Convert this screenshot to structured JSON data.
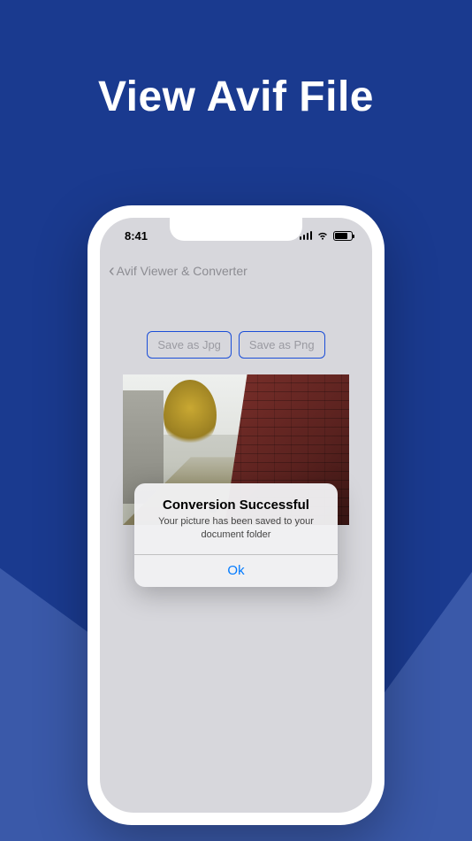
{
  "marketing": {
    "title": "View Avif File"
  },
  "statusbar": {
    "time": "8:41"
  },
  "nav": {
    "back_label": "Avif Viewer & Converter"
  },
  "actions": {
    "save_jpg": "Save as Jpg",
    "save_png": "Save as Png"
  },
  "alert": {
    "title": "Conversion Successful",
    "message": "Your picture has been saved to your document folder",
    "ok": "Ok"
  }
}
